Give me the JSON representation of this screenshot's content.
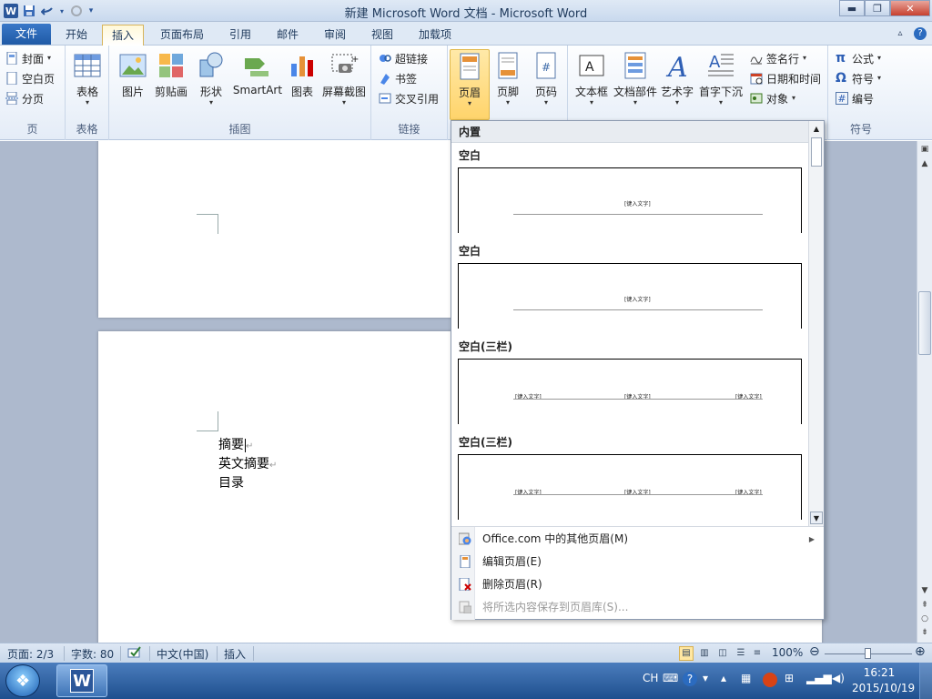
{
  "window": {
    "title": "新建 Microsoft Word 文档 - Microsoft Word",
    "quick_access": [
      "save-icon",
      "undo-icon",
      "redo-icon",
      "customize-icon"
    ]
  },
  "tabs": [
    {
      "label": "文件"
    },
    {
      "label": "开始"
    },
    {
      "label": "插入"
    },
    {
      "label": "页面布局"
    },
    {
      "label": "引用"
    },
    {
      "label": "邮件"
    },
    {
      "label": "审阅"
    },
    {
      "label": "视图"
    },
    {
      "label": "加载项"
    }
  ],
  "ribbon": {
    "pages": {
      "label": "页",
      "items": [
        "封面",
        "空白页",
        "分页"
      ]
    },
    "table": {
      "label": "表格",
      "button": "表格"
    },
    "illustrations": {
      "label": "插图",
      "buttons": [
        "图片",
        "剪贴画",
        "形状",
        "SmartArt",
        "图表",
        "屏幕截图"
      ]
    },
    "links": {
      "label": "链接",
      "items": [
        "超链接",
        "书签",
        "交叉引用"
      ]
    },
    "header_footer": {
      "buttons": [
        "页眉",
        "页脚",
        "页码"
      ]
    },
    "text": {
      "buttons": [
        "文本框",
        "文档部件",
        "艺术字",
        "首字下沉"
      ],
      "items": [
        "签名行",
        "日期和时间",
        "对象"
      ]
    },
    "symbols": {
      "label": "符号",
      "items": [
        "公式",
        "符号",
        "编号"
      ]
    }
  },
  "document": {
    "lines": [
      "摘要",
      "英文摘要",
      "目录"
    ]
  },
  "header_gallery": {
    "section": "内置",
    "items": [
      {
        "title": "空白",
        "placeholders": [
          "[键入文字]"
        ]
      },
      {
        "title": "空白",
        "placeholders": [
          "[键入文字]"
        ]
      },
      {
        "title": "空白(三栏)",
        "placeholders": [
          "[键入文字]",
          "[键入文字]",
          "[键入文字]"
        ]
      },
      {
        "title": "空白(三栏)",
        "placeholders": [
          "[键入文字]",
          "[键入文字]",
          "[键入文字]"
        ]
      }
    ],
    "menu": [
      {
        "label": "Office.com 中的其他页眉(M)",
        "enabled": true,
        "submenu": true
      },
      {
        "label": "编辑页眉(E)",
        "enabled": true
      },
      {
        "label": "删除页眉(R)",
        "enabled": true
      },
      {
        "label": "将所选内容保存到页眉库(S)...",
        "enabled": false
      }
    ]
  },
  "statusbar": {
    "page": "页面: 2/3",
    "words": "字数: 80",
    "language": "中文(中国)",
    "mode": "插入",
    "zoom": "100%"
  },
  "taskbar": {
    "ime": "CH",
    "time": "16:21",
    "date": "2015/10/19"
  }
}
